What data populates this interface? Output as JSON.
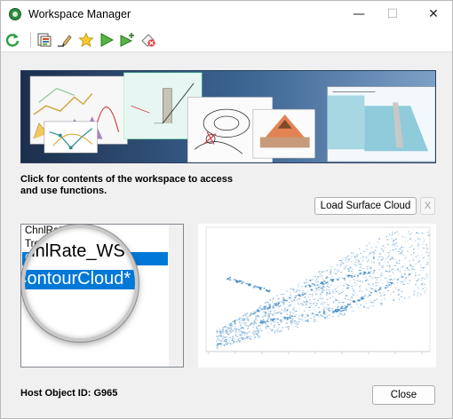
{
  "window": {
    "title": "Workspace Manager",
    "icon": "globe-app-icon",
    "controls": {
      "minimize": "—",
      "maximize": "☐",
      "close": "✕"
    }
  },
  "toolbar": {
    "items": [
      {
        "name": "refresh-icon"
      },
      {
        "name": "workspace-contents-icon"
      },
      {
        "name": "rename-pencil-icon"
      },
      {
        "name": "favorite-star-icon"
      },
      {
        "name": "run-icon"
      },
      {
        "name": "run-new-icon"
      },
      {
        "name": "delete-icon"
      }
    ]
  },
  "instructions": "Click for contents of the workspace to access and use functions.",
  "buttons": {
    "load_surface_cloud": "Load Surface Cloud",
    "clear": "X",
    "close": "Close"
  },
  "workspace_list": {
    "items": [
      {
        "label": "ChnlRate_WSO",
        "selected": false
      },
      {
        "label": "Trench_Rate_drain",
        "selected": false
      },
      {
        "label": "ContourCloud*",
        "selected": true
      }
    ]
  },
  "magnifier": {
    "line1": "ChnlRate_WSO",
    "line2": "ContourCloud*"
  },
  "host_object": "Host Object ID: G965",
  "colors": {
    "selection": "#0078d7",
    "plot_points": "#2f7fc1",
    "banner_bg": "#2f4d77"
  }
}
